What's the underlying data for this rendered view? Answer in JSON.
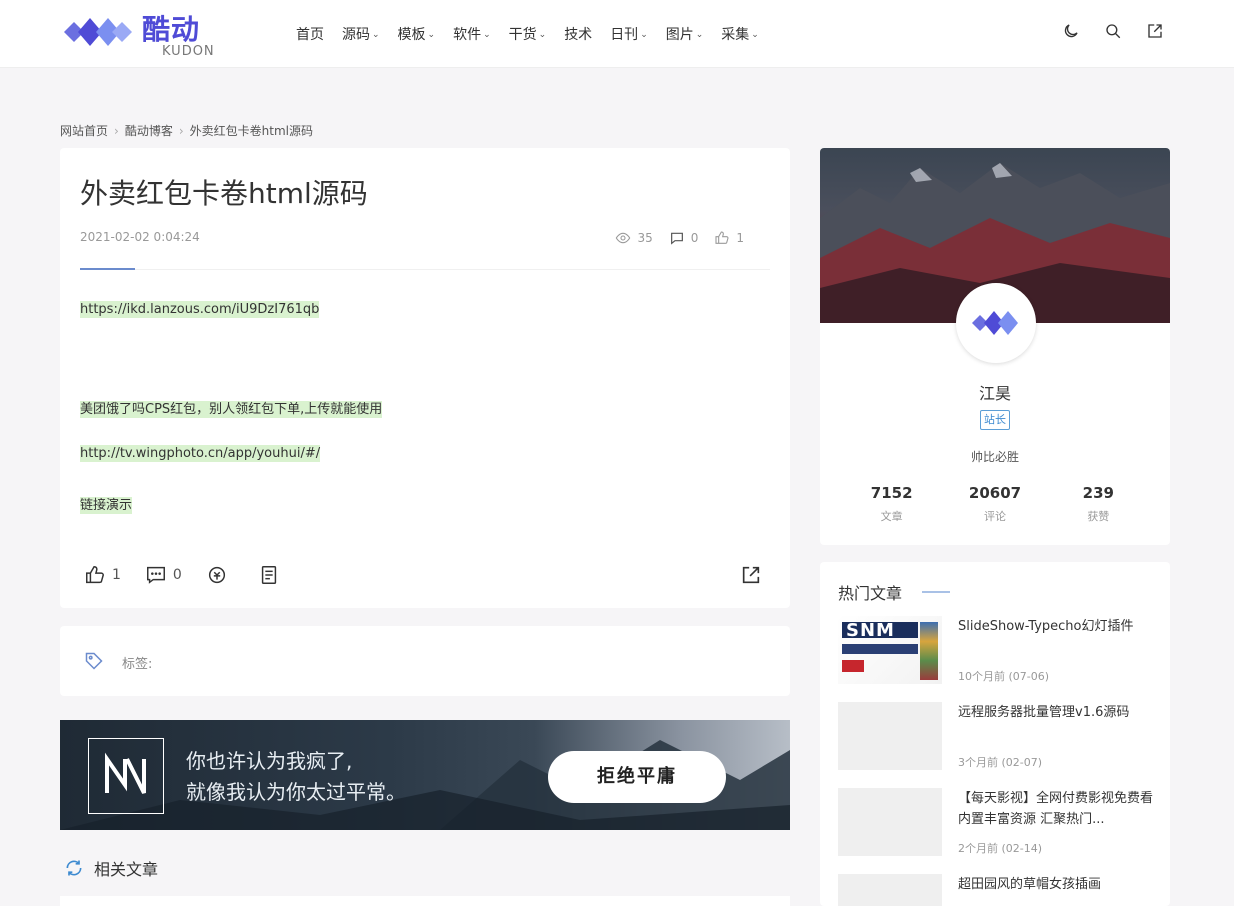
{
  "header": {
    "logo_cn": "酷动",
    "logo_en": "KUDON",
    "nav": [
      {
        "label": "首页",
        "dropdown": false
      },
      {
        "label": "源码",
        "dropdown": true
      },
      {
        "label": "模板",
        "dropdown": true
      },
      {
        "label": "软件",
        "dropdown": true
      },
      {
        "label": "干货",
        "dropdown": true
      },
      {
        "label": "技术",
        "dropdown": false
      },
      {
        "label": "日刊",
        "dropdown": true
      },
      {
        "label": "图片",
        "dropdown": true
      },
      {
        "label": "采集",
        "dropdown": true
      }
    ],
    "icons": [
      "moon-icon",
      "search-icon",
      "edit-icon"
    ]
  },
  "breadcrumb": {
    "items": [
      "网站首页",
      "酷动博客",
      "外卖红包卡卷html源码"
    ]
  },
  "article": {
    "title": "外卖红包卡卷html源码",
    "date": "2021-02-02 0:04:24",
    "views": "35",
    "comments": "0",
    "likes": "1",
    "content": {
      "link1": "https://ikd.lanzous.com/iU9DzI761qb",
      "desc": "美团饿了吗CPS红包，别人领红包下单,上传就能使用",
      "link2": "http://tv.wingphoto.cn/app/youhui/#/",
      "demo": "链接演示"
    },
    "actions": {
      "like_count": "1",
      "comment_count": "0"
    }
  },
  "tags": {
    "label": "标签:"
  },
  "banner": {
    "line1": "你也许认为我疯了,",
    "line2": "就像我认为你太过平常。",
    "button": "拒绝平庸"
  },
  "related": {
    "title": "相关文章"
  },
  "profile": {
    "name": "江昊",
    "badge": "站长",
    "motto": "帅比必胜",
    "stats": [
      {
        "value": "7152",
        "label": "文章"
      },
      {
        "value": "20607",
        "label": "评论"
      },
      {
        "value": "239",
        "label": "获赞"
      }
    ]
  },
  "hot": {
    "title": "热门文章",
    "items": [
      {
        "title": "SlideShow-Typecho幻灯插件",
        "date": "10个月前 (07-06)"
      },
      {
        "title": "远程服务器批量管理v1.6源码",
        "date": "3个月前 (02-07)"
      },
      {
        "title": "【每天影视】全网付费影视免费看 内置丰富资源 汇聚热门...",
        "date": "2个月前 (02-14)"
      },
      {
        "title": "超田园风的草帽女孩插画",
        "date": ""
      }
    ],
    "thumb_text": "SNM"
  },
  "colors": {
    "brand": "#4f4bd6",
    "accent": "#6b8bcd",
    "highlight": "#d9f2cf",
    "badge": "#3d8ad0"
  }
}
